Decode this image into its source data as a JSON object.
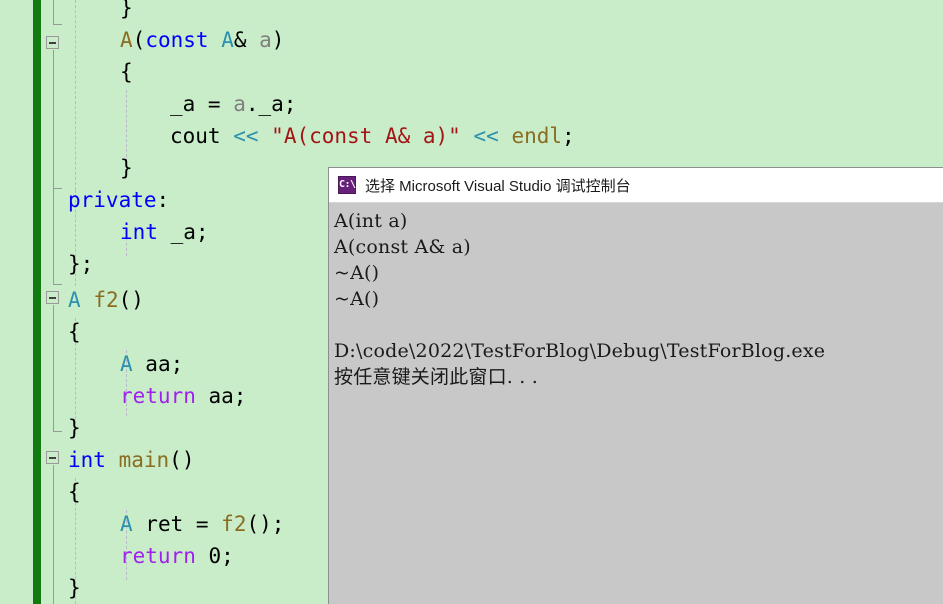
{
  "editor": {
    "language": "cpp",
    "background_color": "#c9ecc9",
    "change_bar_color": "#117a11",
    "lines": [
      {
        "indent": 2,
        "text": "}"
      },
      {
        "indent": 1,
        "text": "A(const A& a)"
      },
      {
        "indent": 1,
        "text": "{"
      },
      {
        "indent": 2,
        "text": "_a = a._a;"
      },
      {
        "indent": 2,
        "text": "cout << \"A(const A& a)\" << endl;"
      },
      {
        "indent": 1,
        "text": "}"
      },
      {
        "indent": 0,
        "text": "private:"
      },
      {
        "indent": 1,
        "text": "int _a;"
      },
      {
        "indent": 0,
        "text": "};"
      },
      {
        "indent": 0,
        "text": "A f2()"
      },
      {
        "indent": 0,
        "text": "{"
      },
      {
        "indent": 1,
        "text": "A aa;"
      },
      {
        "indent": 1,
        "text": "return aa;"
      },
      {
        "indent": 0,
        "text": "}"
      },
      {
        "indent": 0,
        "text": "int main()"
      },
      {
        "indent": 0,
        "text": "{"
      },
      {
        "indent": 1,
        "text": "A ret = f2();"
      },
      {
        "indent": 1,
        "text": "return 0;"
      },
      {
        "indent": 0,
        "text": "}"
      }
    ],
    "colors": {
      "keyword": "#0000ff",
      "user_type": "#2b91af",
      "function": "#8a6d1f",
      "parameter": "#808080",
      "string": "#a31515",
      "operator": "#2b91af",
      "return_keyword": "#a020f0",
      "plain": "#000000"
    }
  },
  "console": {
    "title": "选择 Microsoft Visual Studio 调试控制台",
    "icon": "console-app-icon",
    "icon_glyph": "C:\\",
    "background_color": "#c8c8c8",
    "titlebar_color": "#ffffff",
    "output": [
      "A(int a)",
      "A(const A& a)",
      "~A()",
      "~A()",
      "",
      "D:\\code\\2022\\TestForBlog\\Debug\\TestForBlog.exe",
      "按任意键关闭此窗口. . ."
    ]
  }
}
